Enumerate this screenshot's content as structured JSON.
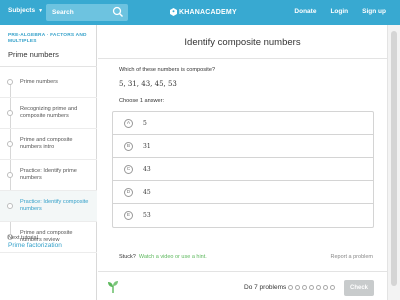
{
  "nav": {
    "subjects": "Subjects",
    "search_placeholder": "Search",
    "logo": "KHANACADEMY",
    "links": [
      "Donate",
      "Login",
      "Sign up"
    ]
  },
  "sidebar": {
    "breadcrumb": "PRE-ALGEBRA · FACTORS AND MULTIPLES",
    "section_title": "Prime numbers",
    "items": [
      {
        "label": "Prime numbers",
        "active": false
      },
      {
        "label": "Recognizing prime and composite numbers",
        "active": false
      },
      {
        "label": "Prime and composite numbers intro",
        "active": false
      },
      {
        "label": "Practice: Identify prime numbers",
        "active": false
      },
      {
        "label": "Practice: Identify composite numbers",
        "active": true
      },
      {
        "label": "Prime and composite numbers review",
        "active": false
      }
    ],
    "next_tutorial_label": "Next tutorial",
    "next_tutorial_link": "Prime factorization"
  },
  "exercise": {
    "title": "Identify composite numbers",
    "question": "Which of these numbers is composite?",
    "numbers": "5, 31, 43, 45, 53",
    "choose_label": "Choose 1 answer:",
    "choices": [
      {
        "letter": "A",
        "value": "5"
      },
      {
        "letter": "B",
        "value": "31"
      },
      {
        "letter": "C",
        "value": "43"
      },
      {
        "letter": "D",
        "value": "45"
      },
      {
        "letter": "E",
        "value": "53"
      }
    ],
    "stuck_label": "Stuck?",
    "hint_link": "Watch a video or use a hint.",
    "report_link": "Report a problem"
  },
  "footer": {
    "progress_label": "Do 7 problems",
    "problems_total": 7,
    "check_label": "Check"
  },
  "colors": {
    "brand": "#38a9d1",
    "link": "#33a0c9",
    "hint": "#5cb85c",
    "check_disabled": "#c8cbcc"
  }
}
